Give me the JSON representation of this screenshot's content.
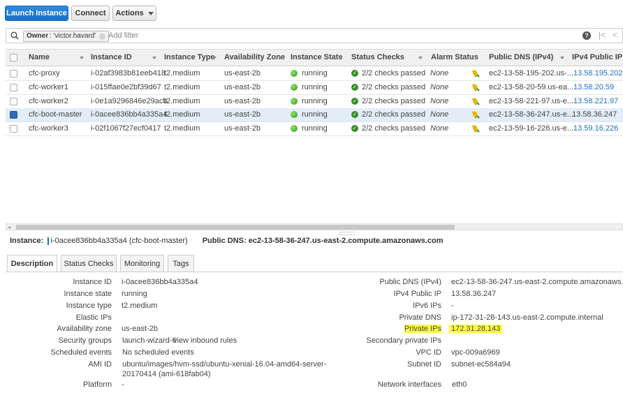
{
  "toolbar": {
    "launch_label": "Launch Instance",
    "connect_label": "Connect",
    "actions_label": "Actions"
  },
  "filter": {
    "token_key": "Owner",
    "token_value": ": 'victor.havard'",
    "placeholder": "Add filter"
  },
  "columns": {
    "name": "Name",
    "instance_id": "Instance ID",
    "instance_type": "Instance Type",
    "az": "Availability Zone",
    "state": "Instance State",
    "status_checks": "Status Checks",
    "alarm_status": "Alarm Status",
    "public_dns": "Public DNS (IPv4)",
    "ipv4": "IPv4 Public IP"
  },
  "rows": [
    {
      "name": "cfc-proxy",
      "id": "i-02af3983b81eeb418",
      "type": "t2.medium",
      "az": "us-east-2b",
      "state": "running",
      "checks": "2/2 checks passed",
      "alarm": "None",
      "dns": "ec2-13-58-195-202.us-...",
      "ip": "13.58.195.202",
      "selected": false
    },
    {
      "name": "cfc-worker1",
      "id": "i-015ffae0e2bf39d67",
      "type": "t2.medium",
      "az": "us-east-2b",
      "state": "running",
      "checks": "2/2 checks passed",
      "alarm": "None",
      "dns": "ec2-13-58-20-59.us-ea...",
      "ip": "13.58.20.59",
      "selected": false
    },
    {
      "name": "cfc-worker2",
      "id": "i-0e1a9296846e29acb",
      "type": "t2.medium",
      "az": "us-east-2b",
      "state": "running",
      "checks": "2/2 checks passed",
      "alarm": "None",
      "dns": "ec2-13-58-221-97.us-e...",
      "ip": "13.58.221.97",
      "selected": false
    },
    {
      "name": "cfc-boot-master",
      "id": "i-0acee836bb4a335a4",
      "type": "t2.medium",
      "az": "us-east-2b",
      "state": "running",
      "checks": "2/2 checks passed",
      "alarm": "None",
      "dns": "ec2-13-58-36-247.us-e...",
      "ip": "13.58.36.247",
      "selected": true
    },
    {
      "name": "cfc-worker3",
      "id": "i-02f1067f27ecf0417",
      "type": "t2.medium",
      "az": "us-east-2b",
      "state": "running",
      "checks": "2/2 checks passed",
      "alarm": "None",
      "dns": "ec2-13-59-16-226.us-e...",
      "ip": "13.59.16.226",
      "selected": false
    }
  ],
  "detail_header": {
    "instance_label": "Instance:",
    "instance_value": "i-0acee836bb4a335a4 (cfc-boot-master)",
    "dns_label": "Public DNS:",
    "dns_value": "ec2-13-58-36-247.us-east-2.compute.amazonaws.com"
  },
  "tabs": [
    "Description",
    "Status Checks",
    "Monitoring",
    "Tags"
  ],
  "details_left": [
    {
      "label": "Instance ID",
      "value": "i-0acee836bb4a335a4",
      "link": false
    },
    {
      "label": "Instance state",
      "value": "running",
      "link": false
    },
    {
      "label": "Instance type",
      "value": "t2.medium",
      "link": false
    },
    {
      "label": "Elastic IPs",
      "value": "",
      "link": false
    },
    {
      "label": "Availability zone",
      "value": "us-east-2b",
      "link": false
    },
    {
      "label": "Security groups",
      "value": "launch-wizard-6 .",
      "value2": "view inbound rules",
      "link": true
    },
    {
      "label": "Scheduled events",
      "value": "No scheduled events",
      "link": true
    },
    {
      "label": "AMI ID",
      "value": "ubuntu/images/hvm-ssd/ubuntu-xenial-16.04-amd64-server-",
      "value2": "20170414 (ami-618fab04)",
      "link": true
    },
    {
      "label": "Platform",
      "value": "-",
      "link": false
    }
  ],
  "details_right": [
    {
      "label": "Public DNS (IPv4)",
      "value": "ec2-13-58-36-247.us-east-2.compute.amazonaws.com",
      "link": false
    },
    {
      "label": "IPv4 Public IP",
      "value": "13.58.36.247",
      "link": false
    },
    {
      "label": "IPv6 IPs",
      "value": "-",
      "link": false
    },
    {
      "label": "Private DNS",
      "value": "ip-172-31-28-143.us-east-2.compute.internal",
      "link": false
    },
    {
      "label": "Private IPs",
      "value": "172.31.28.143",
      "link": false,
      "highlight": true
    },
    {
      "label": "Secondary private IPs",
      "value": "",
      "link": false
    },
    {
      "label": "VPC ID",
      "value": "vpc-009a6969",
      "link": false
    },
    {
      "label": "Subnet ID",
      "value": "subnet-ec584a94",
      "link": false
    },
    {
      "label": "Network interfaces",
      "value": "eth0",
      "link": true
    }
  ],
  "colors": {
    "primary": "#1a6fc9",
    "link": "#1f6fbf",
    "selected_row": "#e3edf8",
    "highlight": "#ffff3a"
  }
}
